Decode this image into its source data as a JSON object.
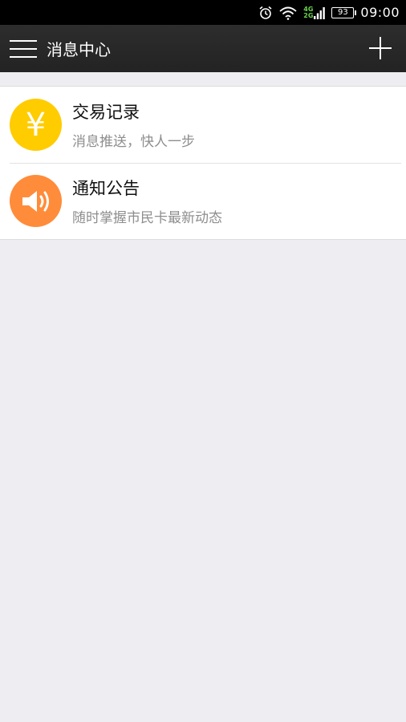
{
  "status_bar": {
    "network_top": "4G",
    "network_bottom": "2G",
    "battery": "93",
    "time": "09:00"
  },
  "app_bar": {
    "title": "消息中心"
  },
  "messages": [
    {
      "title": "交易记录",
      "subtitle": "消息推送，快人一步",
      "icon": "yen-icon",
      "color": "#ffcc00",
      "glyph": "¥"
    },
    {
      "title": "通知公告",
      "subtitle": "随时掌握市民卡最新动态",
      "icon": "speaker-icon",
      "color": "#ff8c3a"
    }
  ]
}
